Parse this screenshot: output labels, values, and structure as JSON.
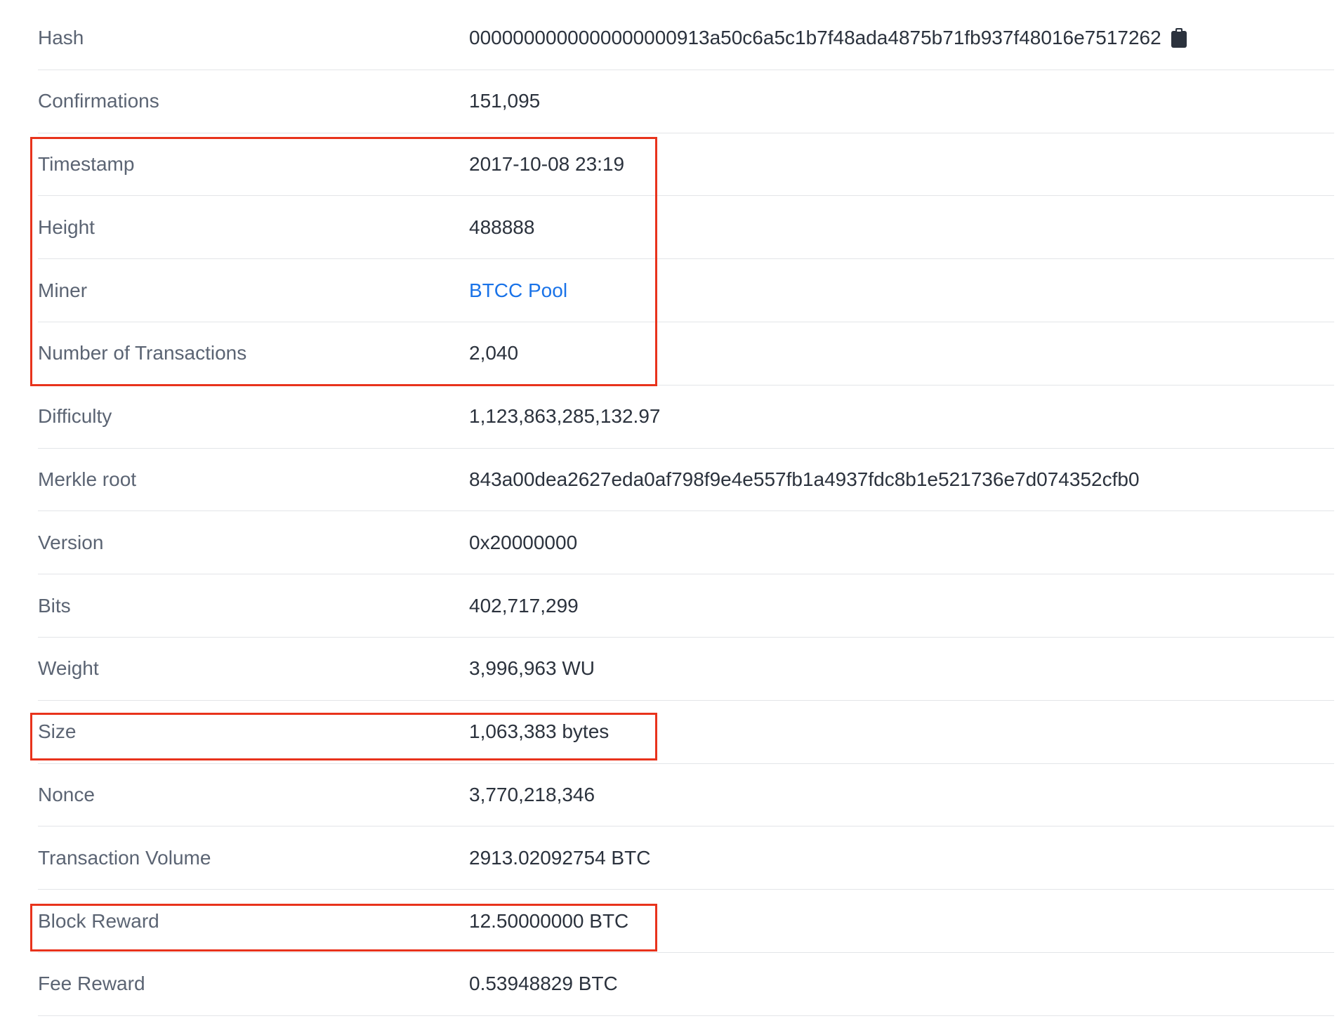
{
  "block_details": {
    "rows": [
      {
        "label": "Hash",
        "value": "0000000000000000000913a50c6a5c1b7f48ada4875b71fb937f48016e7517262"
      },
      {
        "label": "Confirmations",
        "value": "151,095"
      },
      {
        "label": "Timestamp",
        "value": "2017-10-08 23:19"
      },
      {
        "label": "Height",
        "value": "488888"
      },
      {
        "label": "Miner",
        "value": "BTCC Pool"
      },
      {
        "label": "Number of Transactions",
        "value": "2,040"
      },
      {
        "label": "Difficulty",
        "value": "1,123,863,285,132.97"
      },
      {
        "label": "Merkle root",
        "value": "843a00dea2627eda0af798f9e4e557fb1a4937fdc8b1e521736e7d074352cfb0"
      },
      {
        "label": "Version",
        "value": "0x20000000"
      },
      {
        "label": "Bits",
        "value": "402,717,299"
      },
      {
        "label": "Weight",
        "value": "3,996,963 WU"
      },
      {
        "label": "Size",
        "value": "1,063,383 bytes"
      },
      {
        "label": "Nonce",
        "value": "3,770,218,346"
      },
      {
        "label": "Transaction Volume",
        "value": "2913.02092754 BTC"
      },
      {
        "label": "Block Reward",
        "value": "12.50000000 BTC"
      },
      {
        "label": "Fee Reward",
        "value": "0.53948829 BTC"
      }
    ]
  },
  "icons": {
    "copy": "clipboard-icon"
  },
  "colors": {
    "label": "#5b6473",
    "value": "#2b323d",
    "link": "#1a73e8",
    "highlight": "#e8331c",
    "divider": "#e3e5e8"
  }
}
